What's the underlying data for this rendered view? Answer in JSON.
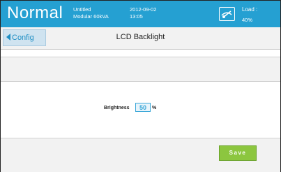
{
  "header": {
    "status": "Normal",
    "config_name": "Untitled",
    "model": "Modular 60kVA",
    "date": "2012-09-02",
    "time": "13:05",
    "load_label": "Load :",
    "load_value": "40%",
    "load_icon": "load-gauge-icon"
  },
  "nav": {
    "back_label": "Config",
    "title": "LCD Backlight"
  },
  "form": {
    "brightness_label": "Brightness",
    "brightness_value": "50",
    "unit": "%"
  },
  "actions": {
    "save_label": "Save"
  },
  "colors": {
    "header": "#25a0d2",
    "save": "#8cc63f",
    "accent": "#3aa7d8"
  }
}
